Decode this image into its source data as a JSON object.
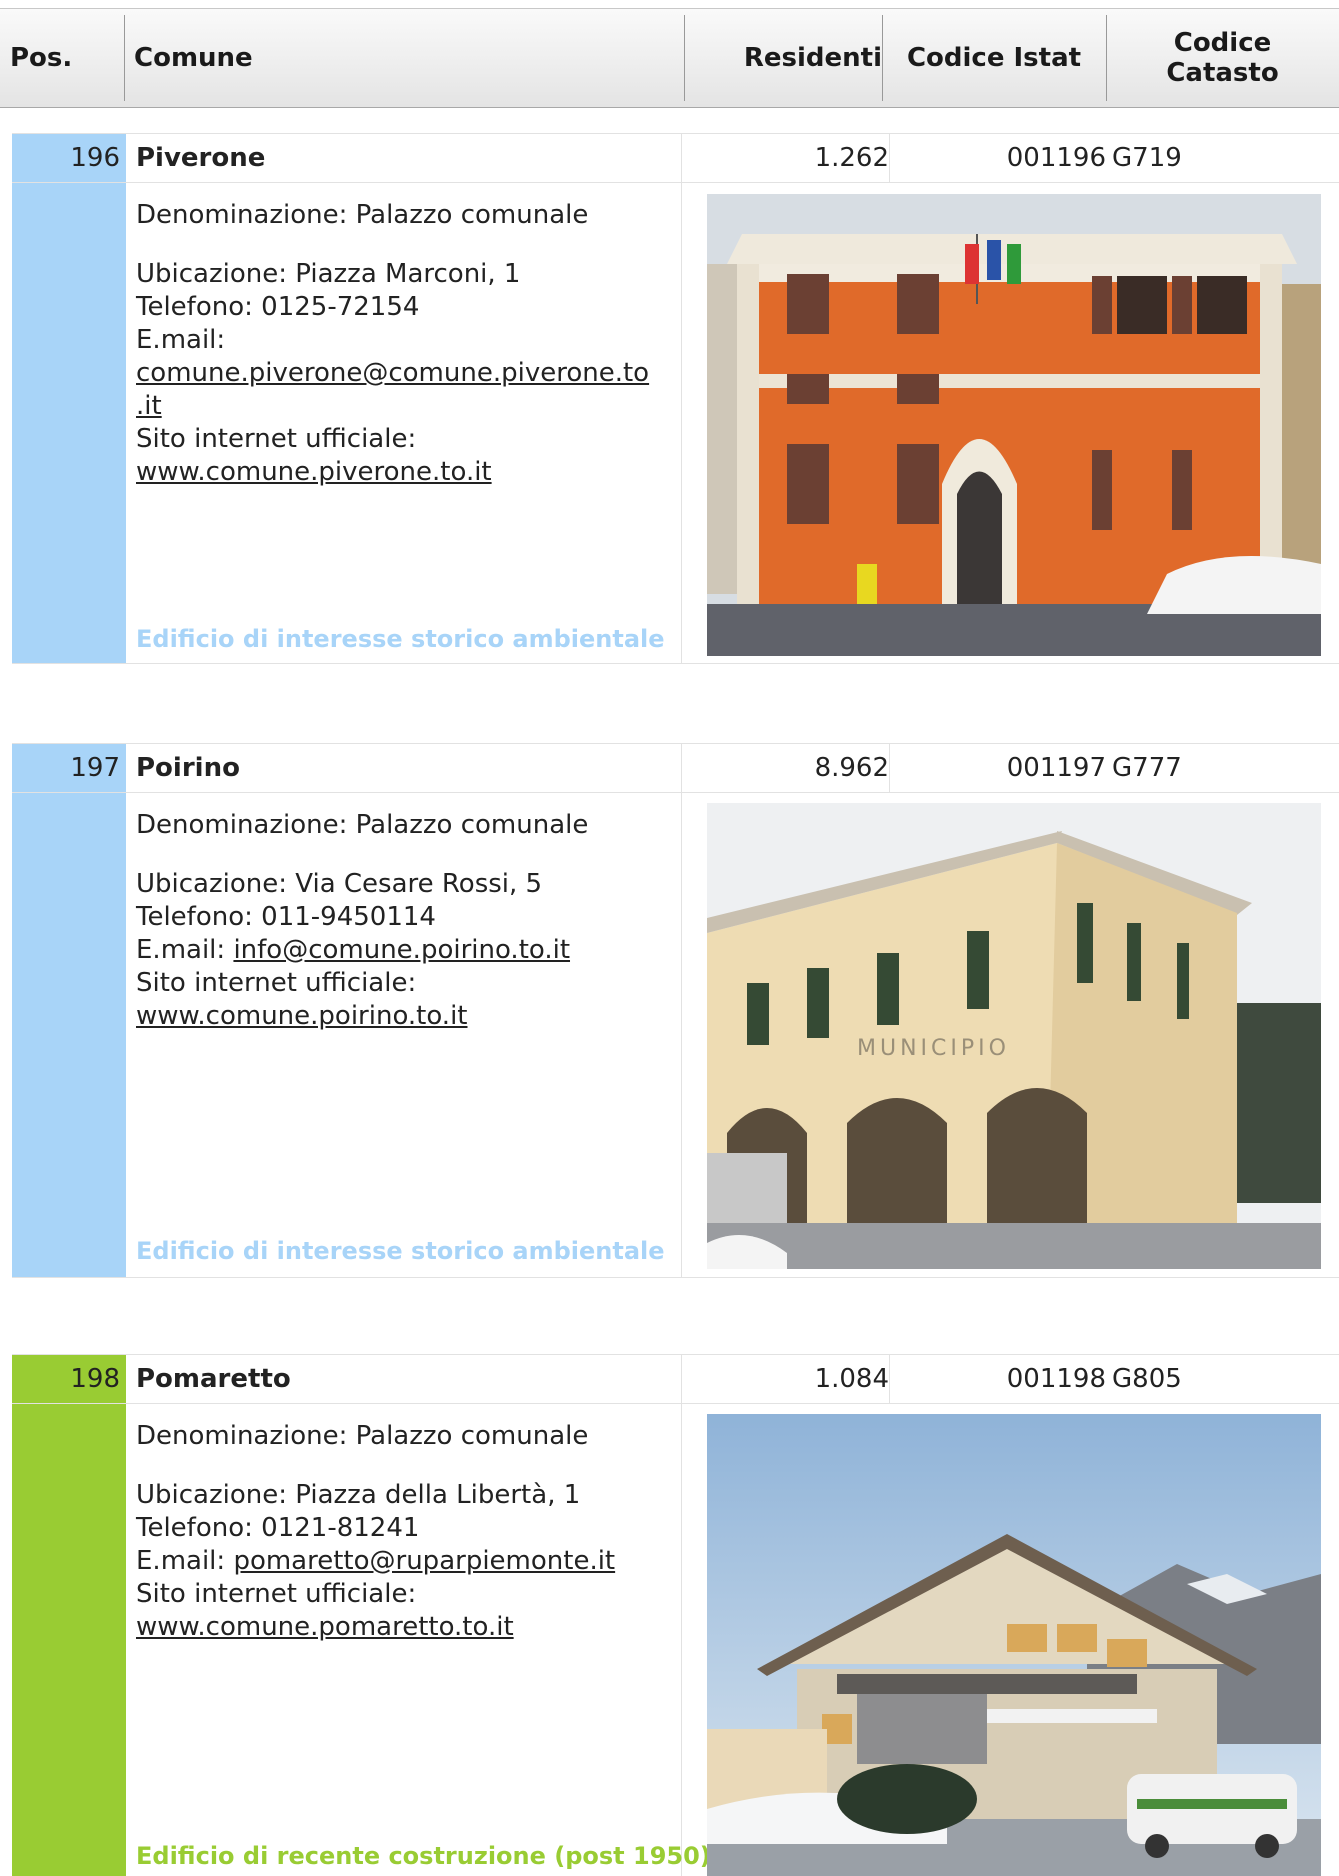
{
  "header": {
    "pos": "Pos.",
    "comune": "Comune",
    "residenti": "Residenti",
    "codice_istat": "Codice Istat",
    "codice_catasto_line1": "Codice",
    "codice_catasto_line2": "Catasto"
  },
  "entries": [
    {
      "pos": "196",
      "name": "Piverone",
      "residenti": "1.262",
      "istat": "001196",
      "catasto": "G719",
      "denominazione": "Denominazione: Palazzo comunale",
      "ubicazione": "Ubicazione: Piazza Marconi, 1",
      "telefono": "Telefono: 0125-72154",
      "email_label": "E.mail:",
      "email_line1": "comune.piverone@comune.piverone.to",
      "email_line2": ".it",
      "sito_label": "Sito internet ufficiale:",
      "sito": "www.comune.piverone.to.it",
      "note": "Edificio di interesse storico ambientale",
      "stripe_color": "#a8d4f8",
      "note_color": "#a8d4f8",
      "photo_icon": "town-hall-photo"
    },
    {
      "pos": "197",
      "name": "Poirino",
      "residenti": "8.962",
      "istat": "001197",
      "catasto": "G777",
      "denominazione": "Denominazione: Palazzo comunale",
      "ubicazione": "Ubicazione: Via Cesare Rossi, 5",
      "telefono": "Telefono: 011-9450114",
      "email_label": "E.mail:",
      "email": "info@comune.poirino.to.it",
      "sito_label": "Sito internet ufficiale:",
      "sito": "www.comune.poirino.to.it",
      "note": "Edificio di interesse storico ambientale",
      "photo_sign": "MUNICIPIO",
      "stripe_color": "#a8d4f8",
      "note_color": "#a8d4f8",
      "photo_icon": "town-hall-photo"
    },
    {
      "pos": "198",
      "name": "Pomaretto",
      "residenti": "1.084",
      "istat": "001198",
      "catasto": "G805",
      "denominazione": "Denominazione: Palazzo comunale",
      "ubicazione": "Ubicazione: Piazza della Libertà, 1",
      "telefono": "Telefono: 0121-81241",
      "email_label": "E.mail:",
      "email": "pomaretto@ruparpiemonte.it",
      "sito_label": "Sito internet ufficiale:",
      "sito": "www.comune.pomaretto.to.it",
      "note": "Edificio di recente costruzione (post 1950)",
      "stripe_color": "#99cc33",
      "note_color": "#99cc33",
      "photo_icon": "town-hall-photo"
    }
  ]
}
